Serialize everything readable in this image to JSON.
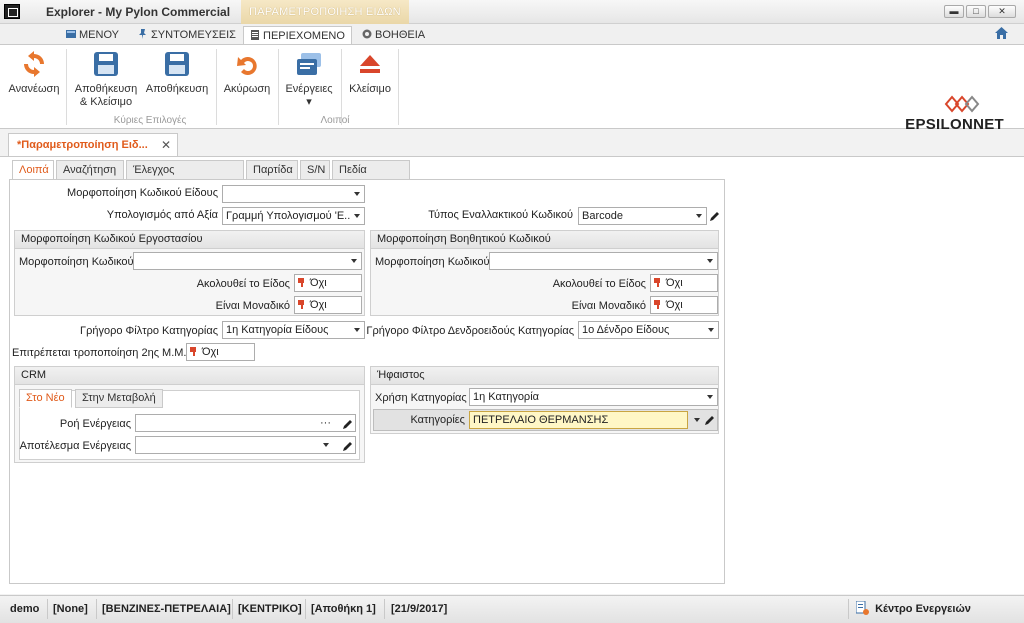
{
  "titlebar": {
    "app_title": "Explorer - My Pylon Commercial",
    "context_title": "ΠΑΡΑΜΕΤΡΟΠΟΙΗΣΗ ΕΙΔΩΝ",
    "minimize": "▬",
    "maximize": "□",
    "close": "✕"
  },
  "menu": {
    "tabs": [
      {
        "label": "ΜΕΝΟΥ",
        "icon": "menu-grid-icon"
      },
      {
        "label": "ΣΥΝΤΟΜΕΥΣΕΙΣ",
        "icon": "pin-icon"
      },
      {
        "label": "ΠΕΡΙΕΧΟΜΕΝΟ",
        "icon": "document-icon"
      },
      {
        "label": "ΒΟΗΘΕΙΑ",
        "icon": "help-icon"
      }
    ],
    "active": "ΠΕΡΙΕΧΟΜΕΝΟ"
  },
  "ribbon": {
    "buttons": [
      {
        "label1": "Ανανέωση",
        "label2": "",
        "icon": "refresh-icon"
      },
      {
        "label1": "Αποθήκευση",
        "label2": "& Κλείσιμο",
        "icon": "save-close-icon"
      },
      {
        "label1": "Αποθήκευση",
        "label2": "",
        "icon": "save-icon"
      },
      {
        "label1": "Ακύρωση",
        "label2": "",
        "icon": "undo-icon"
      },
      {
        "label1": "Ενέργειες",
        "label2": "▾",
        "icon": "actions-icon"
      },
      {
        "label1": "Κλείσιμο",
        "label2": "",
        "icon": "eject-icon"
      }
    ],
    "groups": [
      "Κύριες Επιλογές",
      "Λοιποί"
    ],
    "logo": "EPSILONNET"
  },
  "document_tab": {
    "label": "*Παραμετροποίηση Ειδ...",
    "close": "✕"
  },
  "subtabs": [
    "Λοιπά",
    "Αναζήτηση",
    "Έλεγχος Αποθεμάτων",
    "Παρτίδα",
    "S/N",
    "Πεδία Χρήστη"
  ],
  "form": {
    "item_code_format_label": "Μορφοποίηση Κωδικού Είδους",
    "item_code_format_value": "",
    "calc_from_value_label": "Υπολογισμός από Αξία",
    "calc_from_value_value": "Γραμμή Υπολογισμού 'Ε...",
    "alt_code_type_label": "Τύπος Εναλλακτικού Κωδικού",
    "alt_code_type_value": "Barcode",
    "factory_group_title": "Μορφοποίηση  Κωδικού Εργοστασίου",
    "aux_group_title": "Μορφοποίηση Βοηθητικού Κωδικού",
    "code_format_label": "Μορφοποίηση Κωδικού",
    "follows_item_label": "Ακολουθεί το Είδος",
    "is_unique_label": "Είναι Μοναδικό",
    "no_value": "Όχι",
    "quick_cat_filter_label": "Γρήγορο Φίλτρο Κατηγορίας",
    "quick_cat_filter_value": "1η Κατηγορία Είδους",
    "quick_tree_filter_label": "Γρήγορο Φίλτρο Δενδροειδούς Κατηγορίας",
    "quick_tree_filter_value": "1ο Δένδρο Είδους",
    "second_unit_label": "Επιτρέπεται τροποποίηση 2ης Μ.Μ.",
    "crm_title": "CRM",
    "crm_tabs": [
      "Στο Νέο",
      "Στην Μεταβολή"
    ],
    "action_flow_label": "Ροή Ενέργειας",
    "action_result_label": "Αποτέλεσμα Ενέργειας",
    "ifaistos_title": "Ήφαιστος",
    "category_use_label": "Χρήση Κατηγορίας",
    "category_use_value": "1η Κατηγορία",
    "categories_label": "Κατηγορίες",
    "categories_value": "ΠΕΤΡΕΛΑΙΟ ΘΕΡΜΑΝΣΗΣ",
    "ellipsis": "···"
  },
  "statusbar": {
    "user": "demo",
    "none": "[None]",
    "company": "[ΒΕΝΖΙΝΕΣ-ΠΕΤΡΕΛΑΙΑ]",
    "branch": "[ΚΕΝΤΡΙΚΟ]",
    "warehouse": "[Αποθήκη 1]",
    "date": "[21/9/2017]",
    "action_center": "Κέντρο Ενεργειών"
  },
  "colors": {
    "accent": "#e05b1b",
    "context_tab": "#ead7a8",
    "highlight_field": "#fff7c6"
  }
}
